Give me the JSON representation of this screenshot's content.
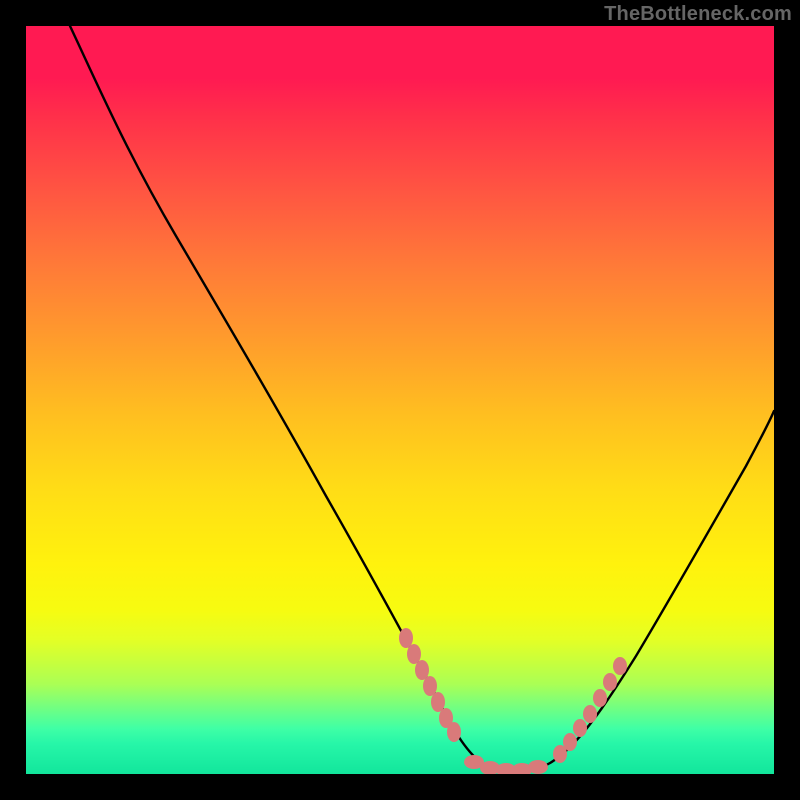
{
  "watermark": "TheBottleneck.com",
  "colors": {
    "background": "#000000",
    "curve": "#000000",
    "beads": "#d97a7a"
  },
  "chart_data": {
    "type": "line",
    "title": "",
    "xlabel": "",
    "ylabel": "",
    "xlim": [
      0,
      100
    ],
    "ylim": [
      0,
      100
    ],
    "grid": false,
    "legend": "none",
    "series": [
      {
        "name": "curve",
        "x": [
          6,
          10,
          15,
          20,
          25,
          30,
          35,
          40,
          45,
          48,
          52,
          55,
          58,
          60,
          62,
          64,
          66,
          70,
          74,
          78,
          82,
          86,
          90,
          94,
          98,
          100
        ],
        "values": [
          100,
          92,
          82,
          72,
          63,
          54,
          45,
          37,
          28,
          22,
          15,
          9,
          4,
          1.5,
          0.5,
          0.3,
          0.3,
          0.5,
          1.5,
          4,
          8,
          14,
          21,
          30,
          40,
          46
        ]
      }
    ],
    "annotations": {
      "bead_clusters": [
        {
          "name": "left-descent",
          "x_range": [
            48,
            56
          ],
          "y_range": [
            9,
            22
          ]
        },
        {
          "name": "minimum-floor",
          "x_range": [
            58,
            68
          ],
          "y_range": [
            0.3,
            1.5
          ]
        },
        {
          "name": "right-ascent",
          "x_range": [
            70,
            78
          ],
          "y_range": [
            1.5,
            9
          ]
        }
      ]
    }
  }
}
